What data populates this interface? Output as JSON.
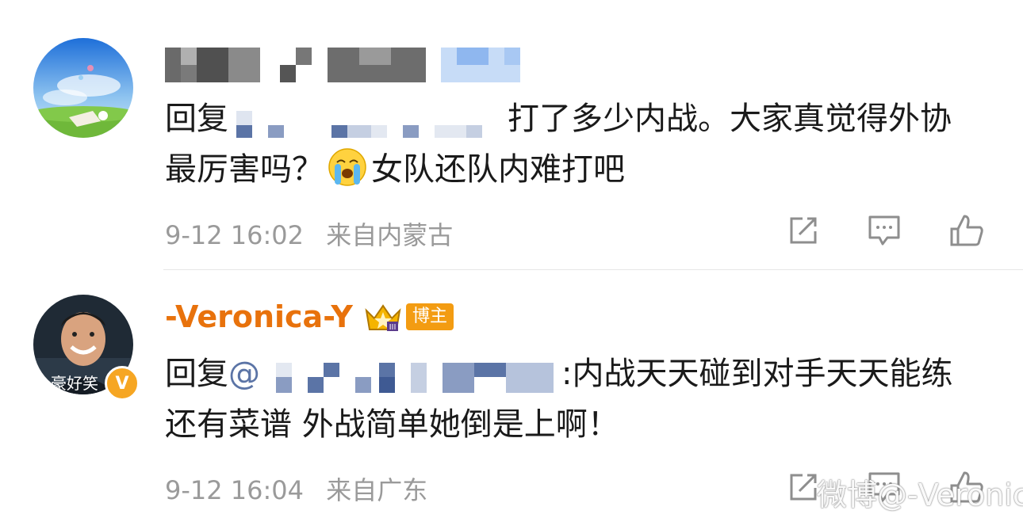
{
  "comments": [
    {
      "reply_prefix": "回复",
      "text_after": "打了多少内战。大家真觉得外协最厉害吗？",
      "text_tail": "女队还队内难打吧",
      "emoji": "crying-face",
      "timestamp": "9-12 16:02",
      "location": "来自内蒙古"
    },
    {
      "username": "-Veronica-Y",
      "badge_label": "博主",
      "reply_prefix": "回复",
      "at_symbol": "@",
      "text_after": ":内战天天碰到对手天天能练还有菜谱 外战简单她倒是上啊！",
      "avatar_caption": "豪好笑",
      "verified_mark": "V",
      "timestamp": "9-12 16:04",
      "location": "来自广东"
    }
  ],
  "watermark": "微博@-Veronica-Y",
  "colors": {
    "username": "#e8720c",
    "meta": "#9a9a9a",
    "badge": "#f39c12"
  },
  "icons": [
    "share-icon",
    "comment-icon",
    "like-icon"
  ]
}
